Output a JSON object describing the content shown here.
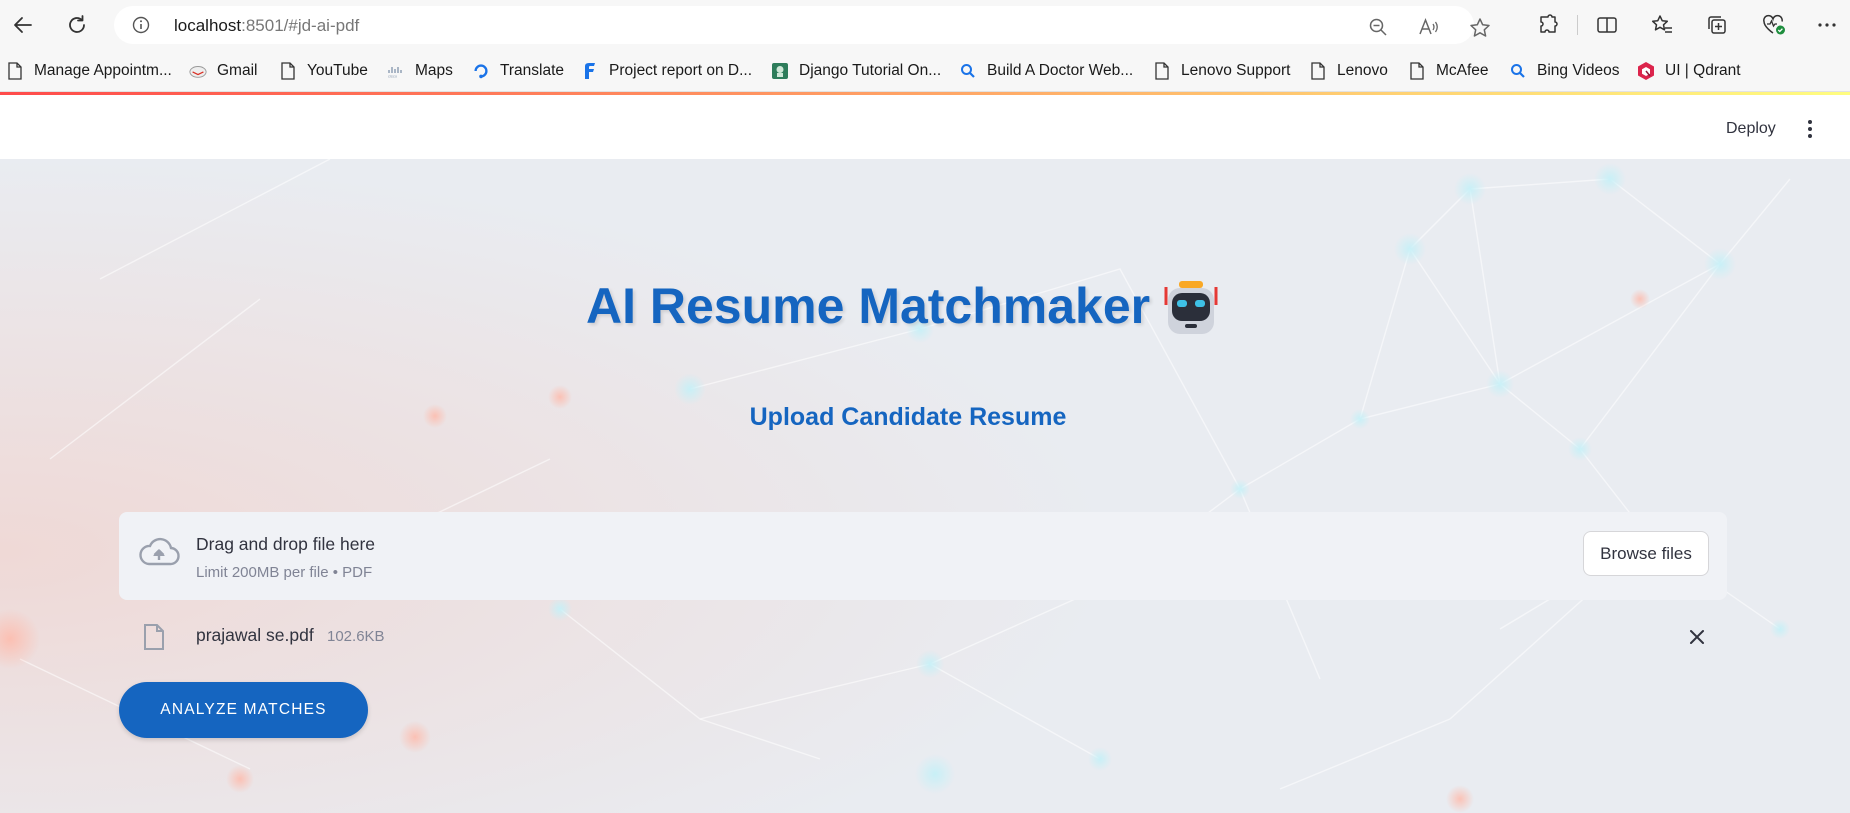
{
  "browser": {
    "url_host": "localhost",
    "url_rest": ":8501/#jd-ai-pdf"
  },
  "bookmarks": [
    {
      "label": "Manage Appointm...",
      "icon": "page-icon"
    },
    {
      "label": "Gmail",
      "icon": "gmail-icon"
    },
    {
      "label": "YouTube",
      "icon": "page-icon"
    },
    {
      "label": "Maps",
      "icon": "cisco-icon"
    },
    {
      "label": "Translate",
      "icon": "translate-icon"
    },
    {
      "label": "Project report on D...",
      "icon": "f-logo-icon"
    },
    {
      "label": "Django Tutorial On...",
      "icon": "django-icon"
    },
    {
      "label": "Build A Doctor Web...",
      "icon": "search-icon"
    },
    {
      "label": "Lenovo Support",
      "icon": "page-icon"
    },
    {
      "label": "Lenovo",
      "icon": "page-icon"
    },
    {
      "label": "McAfee",
      "icon": "page-icon"
    },
    {
      "label": "Bing Videos",
      "icon": "search-icon"
    },
    {
      "label": "UI | Qdrant",
      "icon": "qdrant-icon"
    }
  ],
  "header": {
    "deploy_label": "Deploy"
  },
  "main": {
    "title": "AI Resume Matchmaker",
    "subtitle": "Upload Candidate Resume",
    "uploader": {
      "drag_text": "Drag and drop file here",
      "limit_text": "Limit 200MB per file • PDF",
      "browse_label": "Browse files"
    },
    "file": {
      "name": "prajawal se.pdf",
      "size": "102.6KB"
    },
    "analyze_label": "ANALYZE MATCHES"
  },
  "colors": {
    "accent": "#1565c0",
    "app_background": "#e9ecf1",
    "uploader_background": "#f0f2f6"
  }
}
